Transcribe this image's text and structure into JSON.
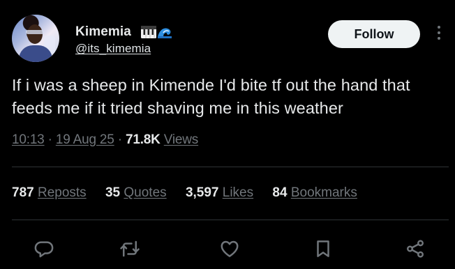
{
  "user": {
    "name": "Kimemia",
    "name_emoji": "🎹🌊",
    "handle": "@its_kimemia",
    "follow_label": "Follow"
  },
  "tweet": {
    "text": "If i was a sheep in Kimende I'd bite tf out the hand that feeds me if it tried shaving me in this weather",
    "time": "10:13",
    "date": "19 Aug 25",
    "views_count": "71.8K",
    "views_label": "Views"
  },
  "stats": [
    {
      "num": "787",
      "label": "Reposts"
    },
    {
      "num": "35",
      "label": "Quotes"
    },
    {
      "num": "3,597",
      "label": "Likes"
    },
    {
      "num": "84",
      "label": "Bookmarks"
    }
  ],
  "colors": {
    "background": "#000000",
    "text_primary": "#e7e9ea",
    "text_secondary": "#71767b",
    "divider": "#2f3336",
    "follow_bg": "#eff3f4"
  },
  "icons": [
    "reply-icon",
    "repost-icon",
    "like-icon",
    "bookmark-icon",
    "share-icon",
    "more-icon"
  ]
}
